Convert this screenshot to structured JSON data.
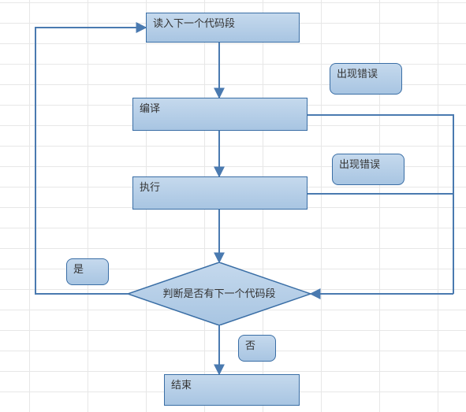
{
  "flow": {
    "read_next": "读入下一个代码段",
    "compile": "编译",
    "execute": "执行",
    "decision": "判断是否有下一个代码段",
    "end": "结束",
    "error1": "出现错误",
    "error2": "出现错误",
    "yes": "是",
    "no": "否"
  },
  "chart_data": {
    "type": "flowchart",
    "nodes": [
      {
        "id": "read_next",
        "shape": "process",
        "label": "读入下一个代码段"
      },
      {
        "id": "compile",
        "shape": "process",
        "label": "编译"
      },
      {
        "id": "execute",
        "shape": "process",
        "label": "执行"
      },
      {
        "id": "decision",
        "shape": "decision",
        "label": "判断是否有下一个代码段"
      },
      {
        "id": "end",
        "shape": "process",
        "label": "结束"
      },
      {
        "id": "error1",
        "shape": "annotation",
        "label": "出现错误"
      },
      {
        "id": "error2",
        "shape": "annotation",
        "label": "出现错误"
      },
      {
        "id": "yes",
        "shape": "annotation",
        "label": "是"
      },
      {
        "id": "no",
        "shape": "annotation",
        "label": "否"
      }
    ],
    "edges": [
      {
        "from": "read_next",
        "to": "compile"
      },
      {
        "from": "compile",
        "to": "execute"
      },
      {
        "from": "execute",
        "to": "decision"
      },
      {
        "from": "decision",
        "to": "end",
        "label": "否"
      },
      {
        "from": "decision",
        "to": "read_next",
        "label": "是"
      },
      {
        "from": "compile",
        "to": "decision",
        "label": "出现错误"
      },
      {
        "from": "execute",
        "to": "decision",
        "label": "出现错误"
      }
    ]
  }
}
